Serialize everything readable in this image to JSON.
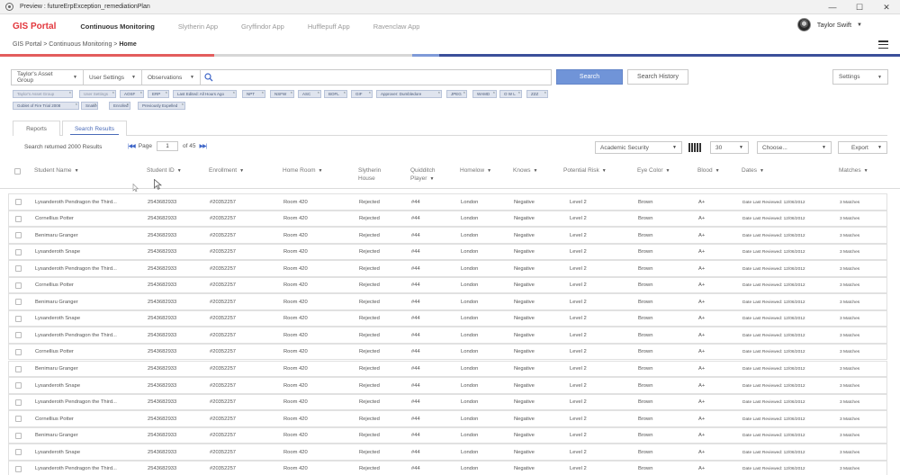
{
  "window": {
    "title": "Preview : futureErpException_remediationPlan",
    "controls": [
      "—",
      "☐",
      "✕"
    ]
  },
  "nav": {
    "brand": "GIS Portal",
    "tabs": [
      "Continuous Monitoring",
      "Slytherin App",
      "Gryffindor App",
      "Hufflepuff App",
      "Ravenclaw App"
    ],
    "active_tab": "Continuous Monitoring",
    "user_name": "Taylor Swift"
  },
  "breadcrumb": {
    "items": [
      "GIS Portal",
      ">",
      "Continuous Monitoring",
      ">"
    ],
    "current": "Home"
  },
  "colorbar": [
    "#e35d5d",
    "#d7d7d7",
    "#7f9ad8",
    "#3b4f9a"
  ],
  "search": {
    "dropdowns": [
      "Taylor's Asset Group",
      "User Settings",
      "Observations"
    ],
    "placeholder": "",
    "value": "",
    "search_button": "Search",
    "history_button": "Search History",
    "settings_label": "Settings"
  },
  "tags": [
    "Taylor's Asset Group",
    "User Settings",
    "AOSF",
    "ERP",
    "Last Edited: All Hours Ago",
    "NPT",
    "NSFW",
    "ASC",
    "BOFL",
    "GIF",
    "Approver: Dumbledore",
    "JPEG",
    "WAMD",
    "O W L",
    "ZZZ",
    "Goblet of Fire Trial 2008",
    "Snake",
    "Enrolled",
    "Previously Expelled"
  ],
  "subtabs": [
    "Reports",
    "Search Results"
  ],
  "active_subtab": "Search Results",
  "toolbar": {
    "result_text": "Search returned 2000 Results",
    "page_label": "Page",
    "page_value": "1",
    "page_of": "of 45",
    "filter_value": "Academic Security",
    "per_page": "30",
    "choose_placeholder": "Choose...",
    "export_label": "Export"
  },
  "table": {
    "columns": [
      "Student Name",
      "Student ID",
      "Enrollment",
      "Home Room",
      "Slytherin House",
      "Quidditch Player",
      "Homelow",
      "Knows",
      "Potential Risk",
      "Eye Color",
      "Blood",
      "Dates",
      "Matches"
    ],
    "rows": [
      [
        "Lysanderoth Pendragon the Third...",
        "2543682933",
        "#20352257",
        "Room 420",
        "Rejected",
        "#44",
        "London",
        "Negative",
        "Level 2",
        "Brown",
        "A+",
        "Date Last Reviewed: 12/06/2012",
        "3 Matches"
      ],
      [
        "Cornellius Potter",
        "2543682933",
        "#20352257",
        "Room 420",
        "Rejected",
        "#44",
        "London",
        "Negative",
        "Level 2",
        "Brown",
        "A+",
        "Date Last Reviewed: 12/06/2012",
        "3 Matches"
      ],
      [
        "Benimaru Granger",
        "2543682933",
        "#20352257",
        "Room 420",
        "Rejected",
        "#44",
        "London",
        "Negative",
        "Level 2",
        "Brown",
        "A+",
        "Date Last Reviewed: 12/06/2012",
        "3 Matches"
      ],
      [
        "Lysanderoth Snape",
        "2543682933",
        "#20352257",
        "Room 420",
        "Rejected",
        "#44",
        "London",
        "Negative",
        "Level 2",
        "Brown",
        "A+",
        "Date Last Reviewed: 12/06/2012",
        "3 Matches"
      ],
      [
        "Lysanderoth Pendragon the Third...",
        "2543682933",
        "#20352257",
        "Room 420",
        "Rejected",
        "#44",
        "London",
        "Negative",
        "Level 2",
        "Brown",
        "A+",
        "Date Last Reviewed: 12/06/2012",
        "3 Matches"
      ],
      [
        "Cornellius Potter",
        "2543682933",
        "#20352257",
        "Room 420",
        "Rejected",
        "#44",
        "London",
        "Negative",
        "Level 2",
        "Brown",
        "A+",
        "Date Last Reviewed: 12/06/2012",
        "3 Matches"
      ],
      [
        "Benimaru Granger",
        "2543682933",
        "#20352257",
        "Room 420",
        "Rejected",
        "#44",
        "London",
        "Negative",
        "Level 2",
        "Brown",
        "A+",
        "Date Last Reviewed: 12/06/2012",
        "3 Matches"
      ],
      [
        "Lysanderoth Snape",
        "2543682933",
        "#20352257",
        "Room 420",
        "Rejected",
        "#44",
        "London",
        "Negative",
        "Level 2",
        "Brown",
        "A+",
        "Date Last Reviewed: 12/06/2012",
        "3 Matches"
      ],
      [
        "Lysanderoth Pendragon the Third...",
        "2543682933",
        "#20352257",
        "Room 420",
        "Rejected",
        "#44",
        "London",
        "Negative",
        "Level 2",
        "Brown",
        "A+",
        "Date Last Reviewed: 12/06/2012",
        "3 Matches"
      ],
      [
        "Cornellius Potter",
        "2543682933",
        "#20352257",
        "Room 420",
        "Rejected",
        "#44",
        "London",
        "Negative",
        "Level 2",
        "Brown",
        "A+",
        "Date Last Reviewed: 12/06/2012",
        "3 Matches"
      ],
      [
        "Benimaru Granger",
        "2543682933",
        "#20352257",
        "Room 420",
        "Rejected",
        "#44",
        "London",
        "Negative",
        "Level 2",
        "Brown",
        "A+",
        "Date Last Reviewed: 12/06/2012",
        "3 Matches"
      ],
      [
        "Lysanderoth Snape",
        "2543682933",
        "#20352257",
        "Room 420",
        "Rejected",
        "#44",
        "London",
        "Negative",
        "Level 2",
        "Brown",
        "A+",
        "Date Last Reviewed: 12/06/2012",
        "3 Matches"
      ],
      [
        "Lysanderoth Pendragon the Third...",
        "2543682933",
        "#20352257",
        "Room 420",
        "Rejected",
        "#44",
        "London",
        "Negative",
        "Level 2",
        "Brown",
        "A+",
        "Date Last Reviewed: 12/06/2012",
        "3 Matches"
      ],
      [
        "Cornellius Potter",
        "2543682933",
        "#20352257",
        "Room 420",
        "Rejected",
        "#44",
        "London",
        "Negative",
        "Level 2",
        "Brown",
        "A+",
        "Date Last Reviewed: 12/06/2012",
        "3 Matches"
      ],
      [
        "Benimaru Granger",
        "2543682933",
        "#20352257",
        "Room 420",
        "Rejected",
        "#44",
        "London",
        "Negative",
        "Level 2",
        "Brown",
        "A+",
        "Date Last Reviewed: 12/06/2012",
        "3 Matches"
      ],
      [
        "Lysanderoth Snape",
        "2543682933",
        "#20352257",
        "Room 420",
        "Rejected",
        "#44",
        "London",
        "Negative",
        "Level 2",
        "Brown",
        "A+",
        "Date Last Reviewed: 12/06/2012",
        "3 Matches"
      ],
      [
        "Lysanderoth Pendragon the Third...",
        "2543682933",
        "#20352257",
        "Room 420",
        "Rejected",
        "#44",
        "London",
        "Negative",
        "Level 2",
        "Brown",
        "A+",
        "Date Last Reviewed: 12/06/2012",
        "3 Matches"
      ]
    ]
  }
}
